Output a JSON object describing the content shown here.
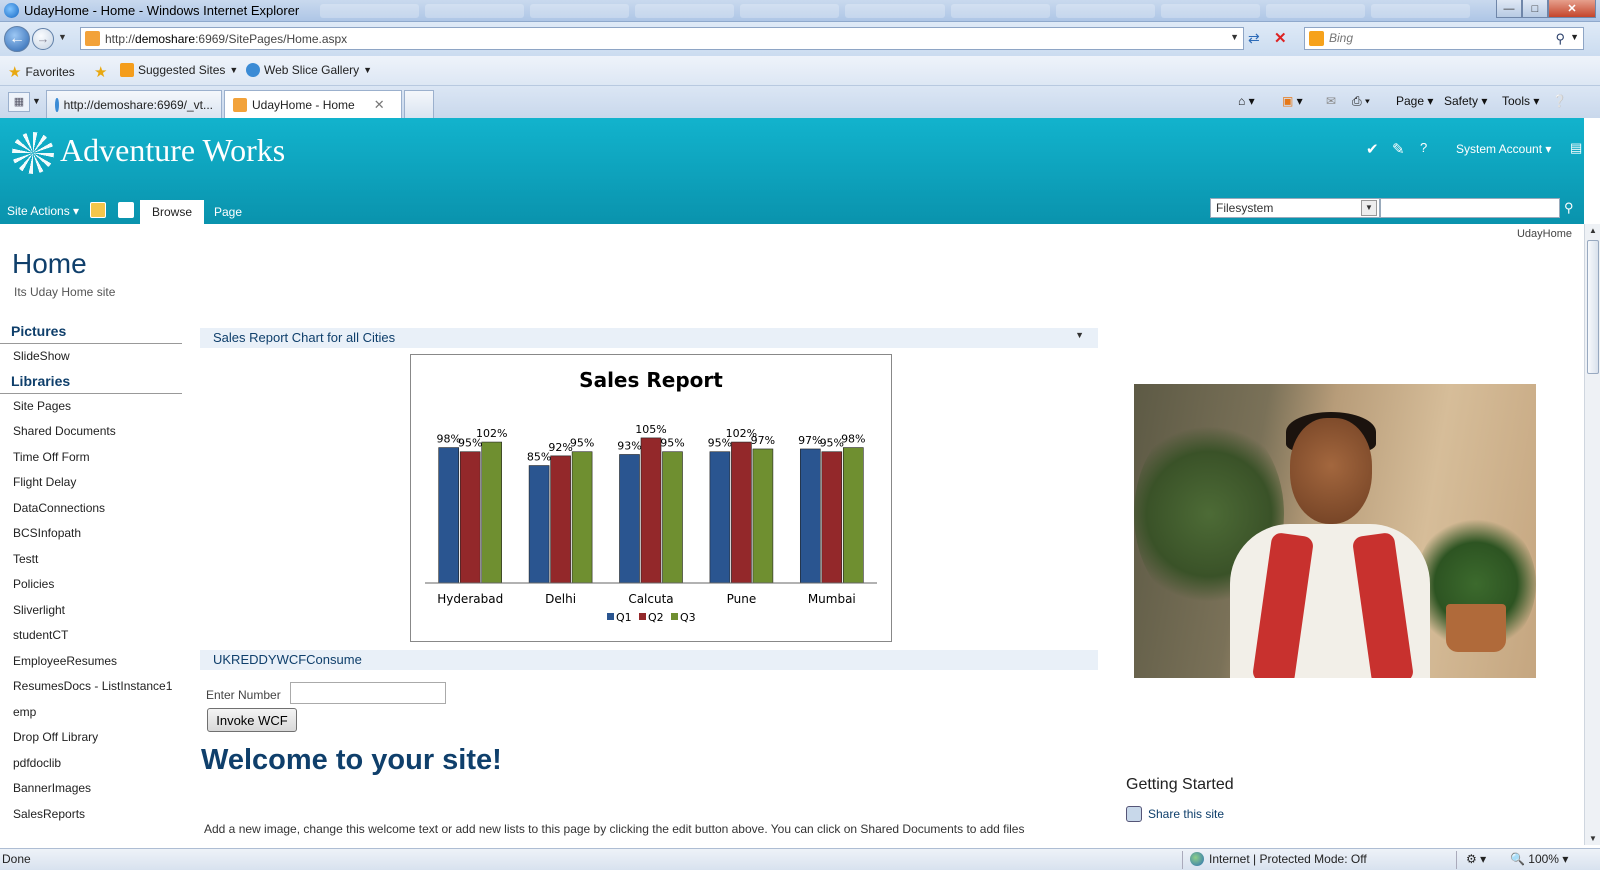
{
  "browser": {
    "window_title": "UdayHome - Home - Windows Internet Explorer",
    "url_host": "demoshare",
    "url_rest": ":6969/SitePages/Home.aspx",
    "url_prefix": "http://",
    "search_placeholder": "Bing",
    "favorites_label": "Favorites",
    "suggested_sites_label": "Suggested Sites",
    "web_slice_label": "Web Slice Gallery",
    "tabs": [
      {
        "label": "http://demoshare:6969/_vt..."
      },
      {
        "label": "UdayHome - Home"
      }
    ],
    "commands": {
      "page": "Page",
      "safety": "Safety",
      "tools": "Tools"
    },
    "status": {
      "left": "Done",
      "zone": "Internet | Protected Mode: Off",
      "zoom": "100%"
    }
  },
  "sharepoint": {
    "site_name": "Adventure Works",
    "user": "System Account",
    "site_actions": "Site Actions",
    "ribbon_tabs": [
      "Browse",
      "Page"
    ],
    "search_scope": "Filesystem",
    "breadcrumb": "UdayHome",
    "page_title": "Home",
    "page_description": "Its Uday Home site",
    "quicklaunch": {
      "pictures_heading": "Pictures",
      "pictures": [
        "SlideShow"
      ],
      "libraries_heading": "Libraries",
      "libraries": [
        "Site Pages",
        "Shared Documents",
        "Time Off Form",
        "Flight Delay",
        "DataConnections",
        "BCSInfopath",
        "Testt",
        "Policies",
        "Sliverlight",
        "studentCT",
        "EmployeeResumes",
        "ResumesDocs - ListInstance1",
        "emp",
        "Drop Off Library",
        "pdfdoclib",
        "BannerImages",
        "SalesReports"
      ]
    },
    "webparts": {
      "chart_title": "Sales Report Chart for all Cities",
      "wcf_title": "UKREDDYWCFConsume",
      "enter_number_label": "Enter Number",
      "enter_number_value": "",
      "invoke_button": "Invoke WCF"
    },
    "welcome_heading": "Welcome to your site!",
    "body_text_cut": "Add a new image, change this welcome text or add new lists to this page by clicking the edit button above. You can click on Shared Documents to add files",
    "getting_started": "Getting Started",
    "share_site": "Share this site"
  },
  "colors": {
    "header": "#0ba3bd",
    "q1": "#2a5590",
    "q2": "#93282a",
    "q3": "#6f8f30",
    "title_text": "#0f3f6b"
  },
  "chart_data": {
    "type": "bar",
    "title": "Sales Report",
    "categories": [
      "Hyderabad",
      "Delhi",
      "Calcuta",
      "Pune",
      "Mumbai"
    ],
    "series": [
      {
        "name": "Q1",
        "values": [
          98,
          85,
          93,
          95,
          97
        ]
      },
      {
        "name": "Q2",
        "values": [
          95,
          92,
          105,
          102,
          95
        ]
      },
      {
        "name": "Q3",
        "values": [
          102,
          95,
          95,
          97,
          98
        ]
      }
    ],
    "value_format": "percent",
    "legend": "bottom",
    "grid": false
  }
}
